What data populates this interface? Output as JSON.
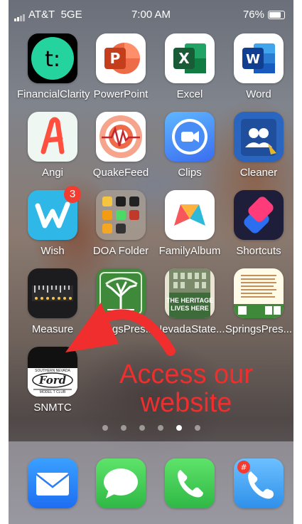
{
  "status_bar": {
    "carrier": "AT&T",
    "network": "5GE",
    "time": "7:00 AM",
    "battery": "76%"
  },
  "home": {
    "apps": [
      {
        "name": "FinancialClarity",
        "icon": "financial-clarity-icon",
        "color": "#24d39e"
      },
      {
        "name": "PowerPoint",
        "icon": "powerpoint-icon",
        "color": "#d04423"
      },
      {
        "name": "Excel",
        "icon": "excel-icon",
        "color": "#1d7245"
      },
      {
        "name": "Word",
        "icon": "word-icon",
        "color": "#2b5cc4"
      },
      {
        "name": "Angi",
        "icon": "angi-icon",
        "color": "#ff5a48"
      },
      {
        "name": "QuakeFeed",
        "icon": "quakefeed-icon",
        "color": "#e8542f"
      },
      {
        "name": "Clips",
        "icon": "clips-icon",
        "color": "#3a7cf5"
      },
      {
        "name": "Cleaner",
        "icon": "cleaner-icon",
        "color": "#2d6cc4"
      },
      {
        "name": "Wish",
        "icon": "wish-icon",
        "color": "#2fb7e8",
        "badge": "3"
      },
      {
        "name": "DOA Folder",
        "icon": "folder-icon",
        "color": "#9b9188"
      },
      {
        "name": "FamilyAlbum",
        "icon": "familyalbum-icon",
        "color": "#ffffff"
      },
      {
        "name": "Shortcuts",
        "icon": "shortcuts-icon",
        "color": "#2b2b5a"
      },
      {
        "name": "Measure",
        "icon": "measure-icon",
        "color": "#1c1c1e"
      },
      {
        "name": "SpringsPres...",
        "icon": "tree-icon",
        "color": "#3f8a3a"
      },
      {
        "name": "NevadaState...",
        "icon": "heritage-icon",
        "color": "#e9e4d4"
      },
      {
        "name": "SpringsPres...",
        "icon": "document-icon",
        "color": "#fffbe6"
      },
      {
        "name": "SNMTC",
        "icon": "ford-club-icon",
        "color": "#ffffff"
      }
    ],
    "heritage_text": [
      "THE HERITAGE",
      "LIVES HERE"
    ],
    "ford_text": {
      "top": "SOUTHERN    NEVADA",
      "brand": "Ford",
      "sub": "MODEL T CLUB"
    }
  },
  "annotation": {
    "line1": "Access our",
    "line2": "website",
    "color": "#f02e2e"
  },
  "page_dots": {
    "count": 6,
    "active": 4
  },
  "dock": [
    {
      "name": "Mail",
      "icon": "mail-icon",
      "color": "#2f8cf6"
    },
    {
      "name": "Messages",
      "icon": "messages-icon",
      "color": "#34c759"
    },
    {
      "name": "Phone",
      "icon": "phone-icon",
      "color": "#34c759"
    },
    {
      "name": "Call Recorder",
      "icon": "call-recorder-icon",
      "color": "#3aa0f0"
    }
  ]
}
